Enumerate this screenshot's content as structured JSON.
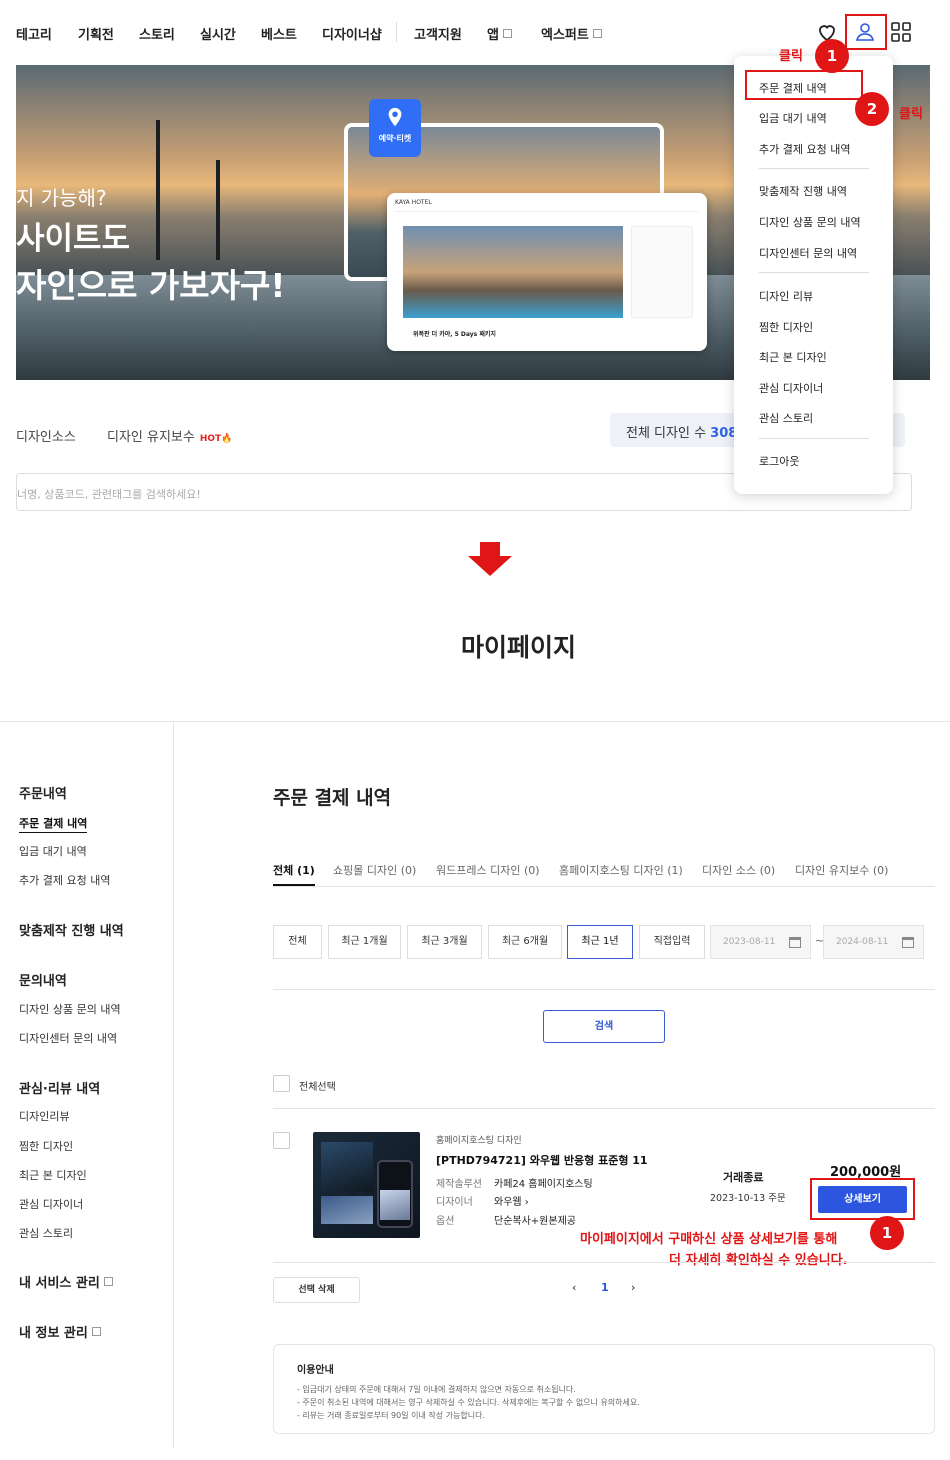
{
  "nav": {
    "items": [
      "테고리",
      "기획전",
      "스토리",
      "실시간",
      "베스트",
      "디자이너샵",
      "고객지원",
      "앱",
      "엑스퍼트"
    ]
  },
  "banner": {
    "line1": "지 가능해?",
    "line2_accent": "",
    "line2": "사이트도",
    "line3": "자인으로 가보자구!",
    "pin_label": "예약·티켓",
    "hotel_name": "KAYA HOTEL",
    "package": "위폭판 더 카야, 5 Days 패키지"
  },
  "subnav": {
    "tab1": "디자인소스",
    "tab2": "디자인 유지보수",
    "hot": "HOT",
    "count_label": "전체 디자인 수",
    "count_value": "308"
  },
  "search": {
    "placeholder": "너명, 상품코드, 관련태그를 검색하세요!"
  },
  "dropdown": {
    "items": [
      "주문 결제 내역",
      "입금 대기 내역",
      "추가 결제 요청 내역",
      "맞춤제작 진행 내역",
      "디자인 상품 문의 내역",
      "디자인센터 문의 내역",
      "디자인 리뷰",
      "찜한 디자인",
      "최근 본 디자인",
      "관심 디자이너",
      "관심 스토리",
      "로그아웃"
    ]
  },
  "annotations": {
    "click": "클릭",
    "badge1": "1",
    "badge2": "2",
    "note_line1": "마이페이지에서 구매하신 상품 상세보기를 통해",
    "note_line2": "더 자세히 확인하실 수 있습니다."
  },
  "mypage_title": "마이페이지",
  "sidebar": {
    "order_head": "주문내역",
    "order_items": [
      "주문 결제 내역",
      "입금 대기 내역",
      "추가 결제 요청 내역"
    ],
    "custom_head": "맞춤제작 진행 내역",
    "inquiry_head": "문의내역",
    "inquiry_items": [
      "디자인 상품 문의 내역",
      "디자인센터 문의 내역"
    ],
    "interest_head": "관심·리뷰 내역",
    "interest_items": [
      "디자인리뷰",
      "찜한 디자인",
      "최근 본 디자인",
      "관심 디자이너",
      "관심 스토리"
    ],
    "service_head": "내 서비스 관리",
    "info_head": "내 정보 관리"
  },
  "main": {
    "title": "주문 결제 내역",
    "tabs": [
      "전체 (1)",
      "쇼핑몰 디자인 (0)",
      "워드프레스 디자인 (0)",
      "홈페이지호스팅 디자인 (1)",
      "디자인 소스 (0)",
      "디자인 유지보수 (0)"
    ],
    "periods": [
      "전체",
      "최근 1개월",
      "최근 3개월",
      "최근 6개월",
      "최근 1년",
      "직접입력"
    ],
    "date_from": "2023-08-11",
    "date_to": "2024-08-11",
    "tilde": "~",
    "search_btn": "검색",
    "select_all": "전체선택",
    "order": {
      "category": "홈페이지호스팅 디자인",
      "name": "[PTHD794721] 와우웹 반응형 표준형 11",
      "meta": [
        {
          "k": "제작솔루션",
          "v": "카페24 홈페이지호스팅"
        },
        {
          "k": "디자이너",
          "v": "와우웹 ›"
        },
        {
          "k": "옵션",
          "v": "단순복사+원본제공"
        }
      ],
      "status": "거래종료",
      "date": "2023-10-13 주문",
      "price": "200,000원",
      "detail_btn": "상세보기"
    },
    "delete_btn": "선택 삭제",
    "pager": {
      "prev": "‹",
      "current": "1",
      "next": "›"
    },
    "info": {
      "title": "이용안내",
      "lines": [
        "- 입금대기 상태의 주문에 대해서 7일 이내에 결제하지 않으면 자동으로 취소됩니다.",
        "- 주문이 취소된 내역에 대해서는 영구 삭제하실 수 있습니다. 삭제후에는 복구할 수 없으니 유의하세요.",
        "- 리뷰는 거래 종료일로부터 90일 이내 작성 가능합니다."
      ]
    }
  },
  "colors": {
    "accent": "#2d56e0",
    "red": "#e01515",
    "hot": "#e8241f"
  }
}
